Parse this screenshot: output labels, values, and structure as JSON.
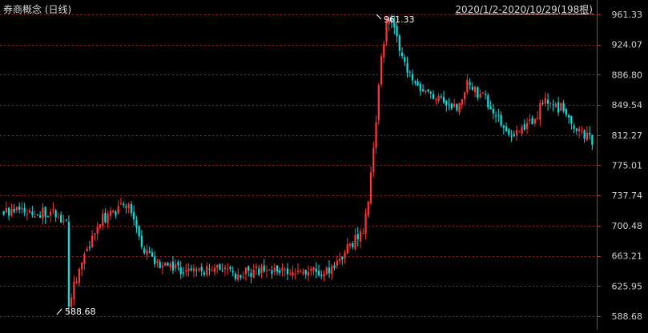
{
  "header": {
    "title": "券商概念 (日线)",
    "range": "2020/1/2-2020/10/29(198根)"
  },
  "chart_data": {
    "type": "candlestick",
    "title": "券商概念 (日线)",
    "period": "2020/1/2-2020/10/29",
    "bar_count": 198,
    "y_ticks": [
      961.33,
      924.07,
      886.8,
      849.54,
      812.27,
      775.01,
      737.74,
      700.48,
      663.21,
      625.95,
      588.68
    ],
    "y_tick_labels": [
      "961.33",
      "924.07",
      "886.80",
      "849.54",
      "812.27",
      "775.01",
      "737.74",
      "700.48",
      "663.21",
      "625.95",
      "588.68"
    ],
    "ylim": [
      588.68,
      961.33
    ],
    "grid": true,
    "annotations": [
      {
        "label": "961.33",
        "value": 961.33,
        "kind": "high"
      },
      {
        "label": "588.68",
        "value": 588.68,
        "kind": "low"
      }
    ],
    "close_anchors": [
      [
        0,
        720
      ],
      [
        6,
        718
      ],
      [
        12,
        718
      ],
      [
        20,
        714
      ],
      [
        24,
        702
      ],
      [
        25,
        600
      ],
      [
        28,
        638
      ],
      [
        36,
        705
      ],
      [
        42,
        716
      ],
      [
        46,
        730
      ],
      [
        50,
        712
      ],
      [
        54,
        670
      ],
      [
        60,
        650
      ],
      [
        70,
        645
      ],
      [
        80,
        648
      ],
      [
        90,
        640
      ],
      [
        100,
        648
      ],
      [
        108,
        643
      ],
      [
        115,
        642
      ],
      [
        125,
        646
      ],
      [
        132,
        672
      ],
      [
        138,
        698
      ],
      [
        140,
        735
      ],
      [
        142,
        800
      ],
      [
        145,
        905
      ],
      [
        147,
        950
      ],
      [
        150,
        950
      ],
      [
        152,
        910
      ],
      [
        158,
        870
      ],
      [
        166,
        855
      ],
      [
        174,
        848
      ],
      [
        178,
        875
      ],
      [
        185,
        857
      ],
      [
        190,
        830
      ],
      [
        196,
        812
      ],
      [
        201,
        822
      ],
      [
        208,
        854
      ],
      [
        214,
        845
      ],
      [
        222,
        812
      ],
      [
        226,
        805
      ]
    ],
    "up_color": "#ff3232",
    "down_color": "#00e0e0",
    "grid_color": "#a02020"
  }
}
